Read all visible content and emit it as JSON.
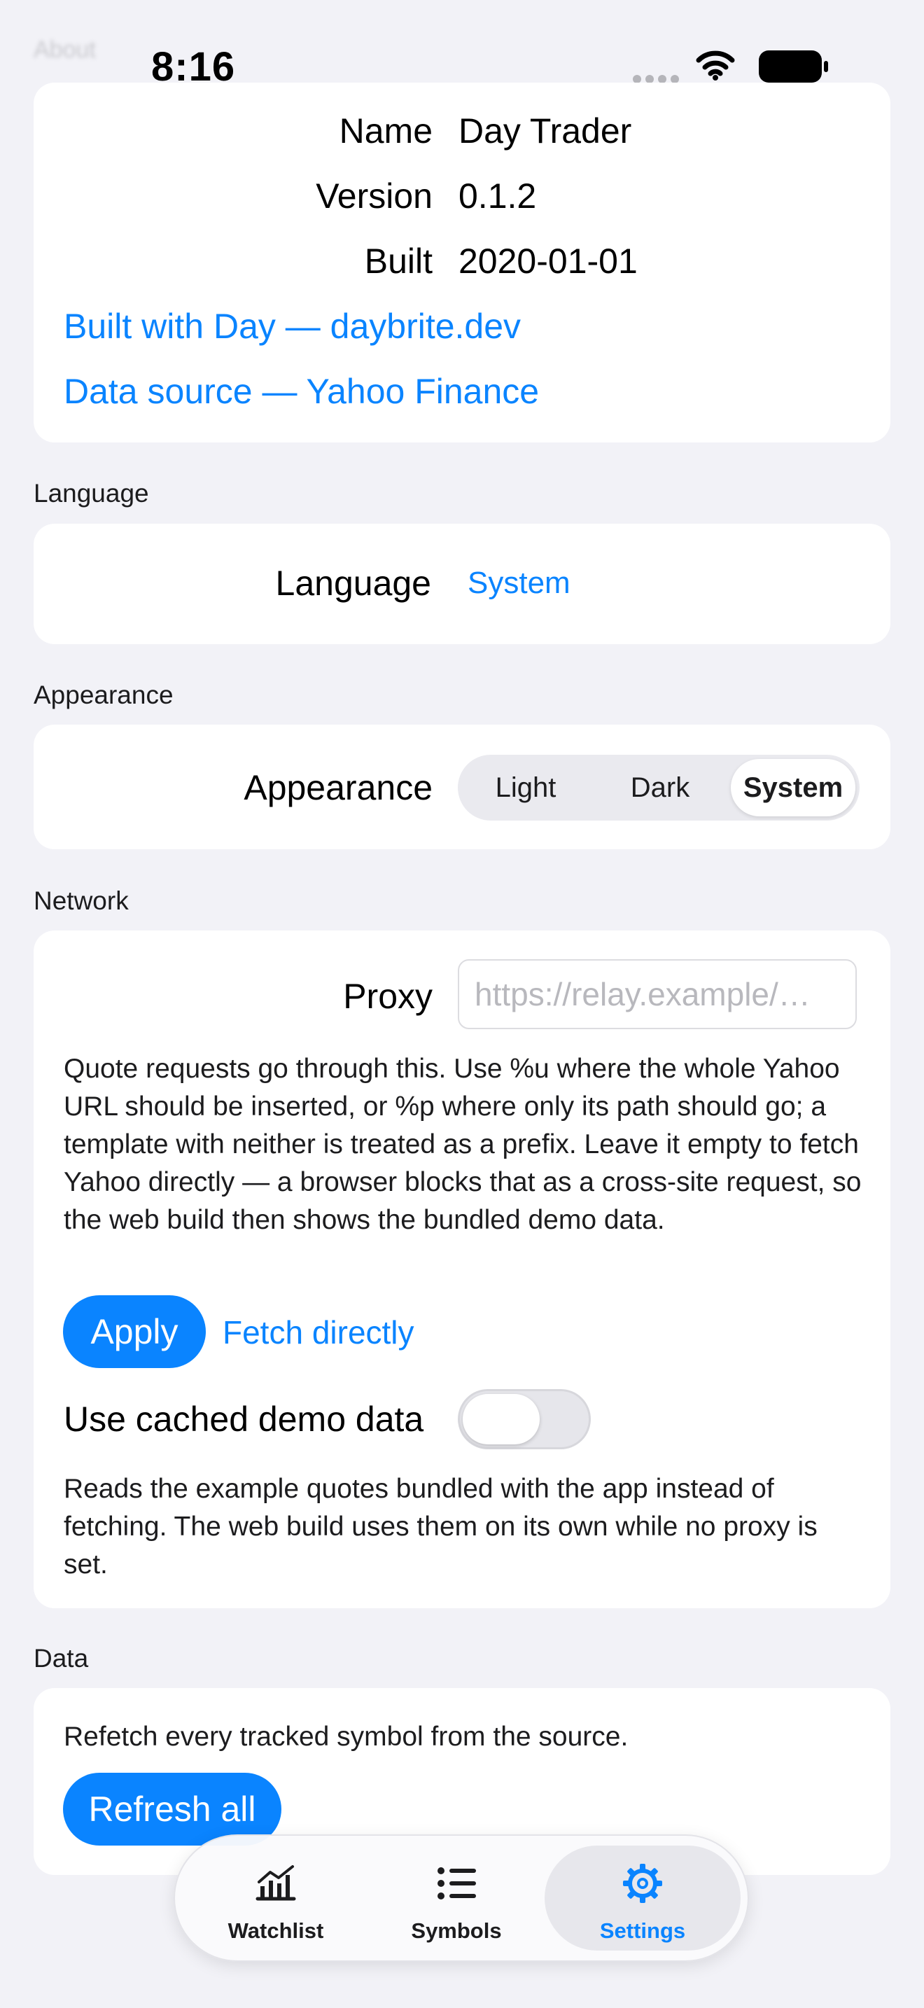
{
  "status_bar": {
    "time": "8:16",
    "ghost_title": "About"
  },
  "about": {
    "rows": [
      {
        "key": "Name",
        "value": "Day Trader"
      },
      {
        "key": "Version",
        "value": "0.1.2"
      },
      {
        "key": "Built",
        "value": "2020-01-01"
      }
    ],
    "links": [
      "Built with Day — daybrite.dev",
      "Data source — Yahoo Finance"
    ]
  },
  "language": {
    "section": "Language",
    "label": "Language",
    "value": "System"
  },
  "appearance": {
    "section": "Appearance",
    "label": "Appearance",
    "options": [
      "Light",
      "Dark",
      "System"
    ],
    "selected": "System"
  },
  "network": {
    "section": "Network",
    "proxy_label": "Proxy",
    "proxy_placeholder": "https://relay.example/…",
    "proxy_help": "Quote requests go through this. Use %u where the whole Yahoo URL should be inserted, or %p where only its path should go; a template with neither is treated as a prefix. Leave it empty to fetch Yahoo directly — a browser blocks that as a cross-site request, so the web build then shows the bundled demo data.",
    "apply_label": "Apply",
    "fetch_directly_label": "Fetch directly",
    "demo_label": "Use cached demo data",
    "demo_enabled": false,
    "demo_help": "Reads the example quotes bundled with the app instead of fetching. The web build uses them on its own while no proxy is set."
  },
  "data_section": {
    "section": "Data",
    "help": "Refetch every tracked symbol from the source.",
    "refresh_label": "Refresh all"
  },
  "tabbar": {
    "tabs": [
      {
        "label": "Watchlist",
        "icon": "chart-icon"
      },
      {
        "label": "Symbols",
        "icon": "list-icon"
      },
      {
        "label": "Settings",
        "icon": "gear-icon"
      }
    ],
    "selected": "Settings"
  },
  "colors": {
    "accent": "#0a84ff",
    "background": "#f2f2f7"
  }
}
